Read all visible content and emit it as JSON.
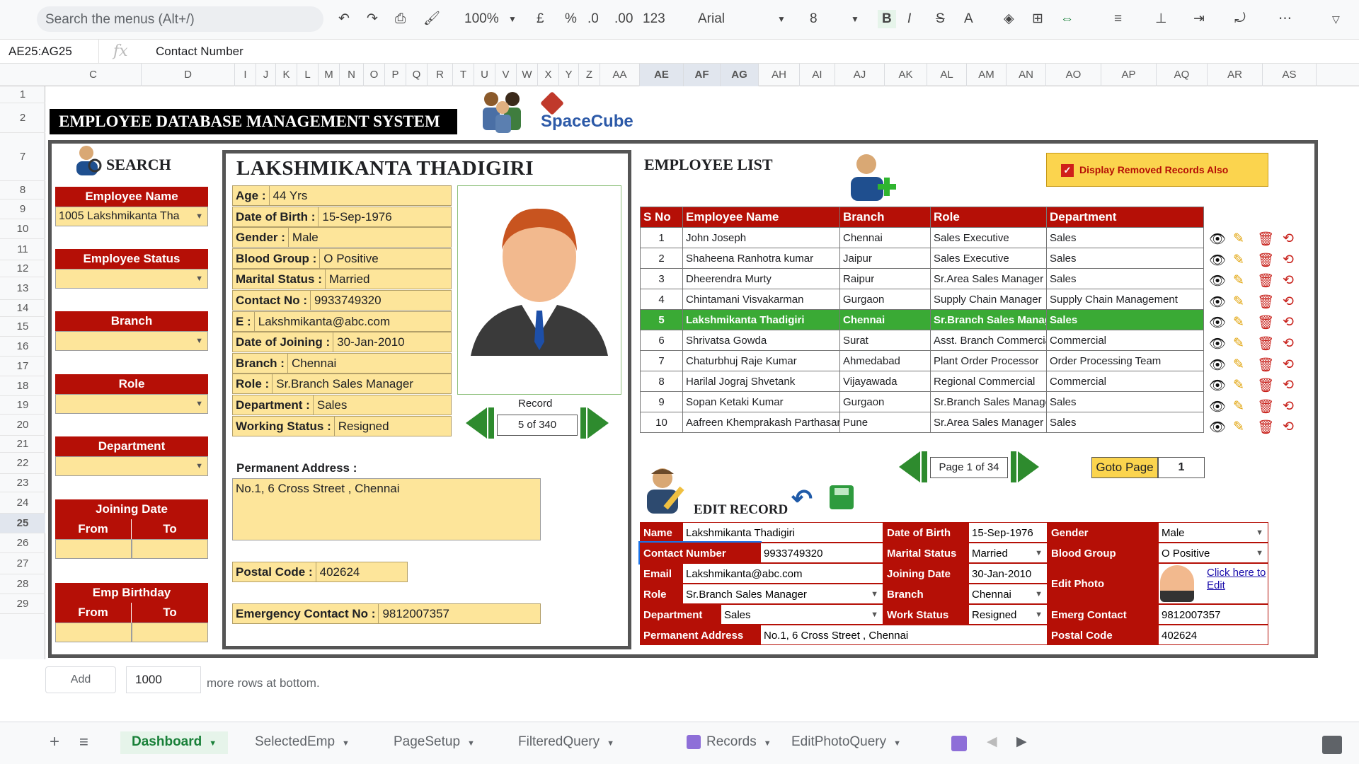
{
  "toolbar": {
    "search_placeholder": "Search the menus (Alt+/)",
    "zoom": "100%",
    "currency": "£",
    "percent": "%",
    "dec_less": ".0",
    "dec_more": ".00",
    "format": "123",
    "font": "Arial",
    "font_size": "8"
  },
  "formula": {
    "cell_ref": "AE25:AG25",
    "fx": "fx",
    "content": "Contact Number"
  },
  "columns": [
    "C",
    "D",
    "I",
    "J",
    "K",
    "L",
    "M",
    "N",
    "O",
    "P",
    "Q",
    "R",
    "T",
    "U",
    "V",
    "W",
    "X",
    "Y",
    "Z",
    "AA",
    "AE",
    "AF",
    "AG",
    "AH",
    "AI",
    "AJ",
    "AK",
    "AL",
    "AM",
    "AN",
    "AO",
    "AP",
    "AQ",
    "AR",
    "AS"
  ],
  "rows": [
    "1",
    "2",
    "7",
    "8",
    "9",
    "10",
    "11",
    "12",
    "13",
    "14",
    "15",
    "16",
    "17",
    "18",
    "19",
    "20",
    "21",
    "22",
    "23",
    "24",
    "25",
    "26",
    "27",
    "28",
    "29"
  ],
  "banner": "EMPLOYEE DATABASE MANAGEMENT SYSTEM",
  "logo": "SpaceCube",
  "search": {
    "title": "SEARCH",
    "emp_name_label": "Employee Name",
    "emp_name_value": "1005 Lakshmikanta Tha",
    "status_label": "Employee Status",
    "branch_label": "Branch",
    "role_label": "Role",
    "dept_label": "Department",
    "join_label": "Joining Date",
    "birthday_label": "Emp Birthday",
    "from": "From",
    "to": "To"
  },
  "profile": {
    "name": "LAKSHMIKANTA THADIGIRI",
    "fields": [
      {
        "k": "Age :",
        "v": "44 Yrs"
      },
      {
        "k": "Date of Birth :",
        "v": "15-Sep-1976"
      },
      {
        "k": "Gender :",
        "v": "Male"
      },
      {
        "k": "Blood Group :",
        "v": "O Positive"
      },
      {
        "k": "Marital Status :",
        "v": "Married"
      },
      {
        "k": "Contact No :",
        "v": "9933749320"
      },
      {
        "k": "E :",
        "v": "Lakshmikanta@abc.com"
      },
      {
        "k": "Date of Joining :",
        "v": "30-Jan-2010"
      },
      {
        "k": "Branch :",
        "v": "Chennai"
      },
      {
        "k": "Role :",
        "v": "Sr.Branch Sales Manager"
      },
      {
        "k": "Department :",
        "v": "Sales"
      },
      {
        "k": "Working Status :",
        "v": "Resigned"
      }
    ],
    "record_label": "Record",
    "record_value": "5 of 340",
    "address_label": "Permanent Address :",
    "address": "No.1, 6 Cross Street , Chennai",
    "postal_label": "Postal Code :",
    "postal": "402624",
    "emerg_label": "Emergency Contact No :",
    "emerg": "9812007357"
  },
  "list": {
    "title": "EMPLOYEE LIST",
    "removed_label": "Display Removed Records Also",
    "headers": [
      "S No",
      "Employee Name",
      "Branch",
      "Role",
      "Department"
    ],
    "rows": [
      [
        "1",
        "John Joseph",
        "Chennai",
        "Sales Executive",
        "Sales"
      ],
      [
        "2",
        "Shaheena Ranhotra kumar",
        "Jaipur",
        "Sales Executive",
        "Sales"
      ],
      [
        "3",
        "Dheerendra Murty",
        "Raipur",
        "Sr.Area Sales Manager",
        "Sales"
      ],
      [
        "4",
        "Chintamani Visvakarman",
        "Gurgaon",
        "Supply Chain Manager",
        "Supply Chain Management"
      ],
      [
        "5",
        "Lakshmikanta Thadigiri",
        "Chennai",
        "Sr.Branch Sales Manager",
        "Sales"
      ],
      [
        "6",
        "Shrivatsa Gowda",
        "Surat",
        "Asst. Branch Commercial",
        "Commercial"
      ],
      [
        "7",
        "Chaturbhuj Raje Kumar",
        "Ahmedabad",
        "Plant Order Processor",
        "Order Processing Team"
      ],
      [
        "8",
        "Harilal Jograj Shvetank",
        "Vijayawada",
        "Regional Commercial",
        "Commercial"
      ],
      [
        "9",
        "Sopan Ketaki Kumar",
        "Gurgaon",
        "Sr.Branch Sales Manager",
        "Sales"
      ],
      [
        "10",
        "Aafreen Khemprakash Parthasarathy",
        "Pune",
        "Sr.Area Sales Manager",
        "Sales"
      ]
    ],
    "page_label": "Page 1 of 34",
    "goto_label": "Goto Page",
    "goto_value": "1"
  },
  "edit": {
    "title": "EDIT RECORD",
    "name_l": "Name",
    "name_v": "Lakshmikanta Thadigiri",
    "dob_l": "Date of Birth",
    "dob_v": "15-Sep-1976",
    "gender_l": "Gender",
    "gender_v": "Male",
    "contact_l": "Contact Number",
    "contact_v": "9933749320",
    "marital_l": "Marital Status",
    "marital_v": "Married",
    "blood_l": "Blood Group",
    "blood_v": "O Positive",
    "email_l": "Email",
    "email_v": "Lakshmikanta@abc.com",
    "join_l": "Joining Date",
    "join_v": "30-Jan-2010",
    "photo_l": "Edit Photo",
    "photo_link": "Click here to Edit",
    "role_l": "Role",
    "role_v": "Sr.Branch Sales Manager",
    "branch_l": "Branch",
    "branch_v": "Chennai",
    "dept_l": "Department",
    "dept_v": "Sales",
    "work_l": "Work Status",
    "work_v": "Resigned",
    "emerg_l": "Emerg Contact",
    "emerg_v": "9812007357",
    "addr_l": "Permanent Address",
    "addr_v": "No.1, 6 Cross Street , Chennai",
    "postal_l": "Postal Code",
    "postal_v": "402624"
  },
  "footer": {
    "add_label": "Add",
    "rows_value": "1000",
    "more_text": "more rows at bottom."
  },
  "tabs": [
    "Dashboard",
    "SelectedEmp",
    "PageSetup",
    "FilteredQuery",
    "Records",
    "EditPhotoQuery"
  ],
  "colors": {
    "accent": "#b50f06",
    "field": "#fde59a",
    "selected": "#3aaa35",
    "tab_active": "#188038"
  }
}
